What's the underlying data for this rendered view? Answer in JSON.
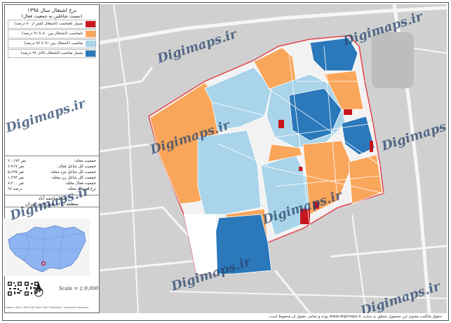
{
  "legend": {
    "title": "نرخ اشتغال سال ۱۳۹۵",
    "subtitle": "(نسبت شاغلین به جمعیت فعال)",
    "items": [
      {
        "label": "بسیار نامناسب (اشتغال کمتر از ۸۰ درصد)",
        "color": "#c8161d"
      },
      {
        "label": "نامناسب (اشتغال بین ۸۰ تا ۹۱ درصد)",
        "color": "#f9a65a"
      },
      {
        "label": "مناسب (اشتغال بین ۹۱ تا ۹۶ درصد)",
        "color": "#a9d4ea"
      },
      {
        "label": "بسیار مناسب (اشتغال بالای ۹۶ درصد)",
        "color": "#2b78bb"
      }
    ]
  },
  "stats": [
    {
      "label": "جمعیت محله:",
      "value": "۲۰،۱۷۳ نفر"
    },
    {
      "label": "جمعیت کل شاغل فعال:",
      "value": "۶،۹۱۷ نفر"
    },
    {
      "label": "جمعیت کل شاغل مرد محله:",
      "value": "۵،۶۲۵ نفر"
    },
    {
      "label": "جمعیت کل شاغل زن محله:",
      "value": "۱،۲۹۳ نفر"
    },
    {
      "label": "جمعیت فعال محله:",
      "value": "۷،۲۰۰ نفر"
    },
    {
      "label": "نرخ اشتغال محله:",
      "value": "۹۶ درصد"
    }
  ],
  "area": {
    "neighborhood": "محله احمد آباد",
    "district": "منطقه (۱۹) شهرداری تهران"
  },
  "scale": "Scale = 1:9,000",
  "north": "N",
  "watermark": "Digimaps.ir",
  "footer": "حقوق مالکیت معنوی این محصول متعلق به سایت www.digimaps.ir بوده و تمامی حقوق آن محفوظ است.",
  "credit": "Datum: WGS 1984 UTM Zone 39N / Projection: Transverse Mercator",
  "colors": {
    "very_poor": "#c8161d",
    "poor": "#f9a65a",
    "good": "#a9d4ea",
    "very_good": "#2b78bb",
    "boundary": "#e5454a",
    "base": "#d0d0d0",
    "road": "#f6f6f6"
  }
}
